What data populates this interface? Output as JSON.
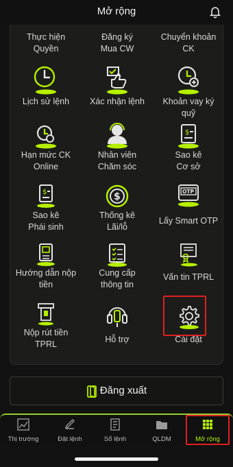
{
  "header": {
    "title": "Mở rộng"
  },
  "menu": [
    {
      "label": "Thực hiện\nQuyền",
      "icon": "rights-icon"
    },
    {
      "label": "Đăng ký\nMua CW",
      "icon": "register-cw-icon"
    },
    {
      "label": "Chuyển khoản\nCK",
      "icon": "transfer-icon"
    },
    {
      "label": "Lịch sử lệnh",
      "icon": "clock-icon"
    },
    {
      "label": "Xác nhận lệnh",
      "icon": "thumb-up-doc-icon"
    },
    {
      "label": "Khoản vay ký\nquỹ",
      "icon": "clock-plus-icon"
    },
    {
      "label": "Hạn mức CK\nOnline",
      "icon": "clock-plus-doc-icon"
    },
    {
      "label": "Nhân viên\nChăm sóc",
      "icon": "support-agent-icon"
    },
    {
      "label": "Sao kê\nCơ sở",
      "icon": "statement-icon"
    },
    {
      "label": "Sao kê\nPhái sinh",
      "icon": "statement-derivative-icon"
    },
    {
      "label": "Thống kê\nLãi/lỗ",
      "icon": "dollar-circle-icon"
    },
    {
      "label": "Lấy Smart OTP",
      "icon": "otp-icon"
    },
    {
      "label": "Hướng dẫn nộp\ntiền",
      "icon": "deposit-guide-icon"
    },
    {
      "label": "Cung cấp\nthông tin",
      "icon": "info-list-icon"
    },
    {
      "label": "Vấn tin TPRL",
      "icon": "certificate-icon"
    },
    {
      "label": "Nộp rút tiền\nTPRL",
      "icon": "atm-icon"
    },
    {
      "label": "Hỗ trợ",
      "icon": "headset-icon"
    },
    {
      "label": "Cài đặt",
      "icon": "gear-icon"
    }
  ],
  "logout": {
    "label": "Đăng xuất"
  },
  "tabs": [
    {
      "label": "Thị trường",
      "icon": "chart-line-icon"
    },
    {
      "label": "Đặt lệnh",
      "icon": "order-icon"
    },
    {
      "label": "Sổ lệnh",
      "icon": "order-book-icon"
    },
    {
      "label": "QLDM",
      "icon": "folder-icon"
    },
    {
      "label": "Mở rộng",
      "icon": "grid-icon"
    }
  ],
  "active_tab": "Mở rộng",
  "colors": {
    "accent": "#b6f000",
    "highlight": "#e02020",
    "background": "#121212"
  }
}
